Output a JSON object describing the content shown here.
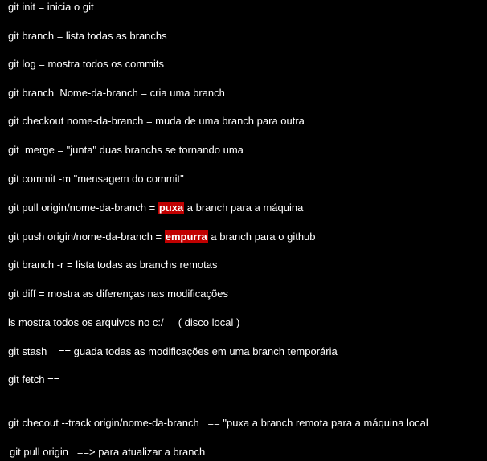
{
  "document": {
    "lines": [
      {
        "text": "git init = inicia o git"
      },
      {
        "text": "git branch = lista todas as branchs"
      },
      {
        "text": "git log = mostra todos os commits"
      },
      {
        "text": "git branch  Nome-da-branch = cria uma branch"
      },
      {
        "text": "git checkout nome-da-branch = muda de uma branch para outra"
      },
      {
        "text": "git  merge = \"junta\" duas branchs se tornando uma"
      },
      {
        "text": "git commit -m \"mensagem do commit\""
      },
      {
        "pre": "git pull origin/nome-da-branch = ",
        "highlight": "puxa",
        "post": " a branch para a máquina"
      },
      {
        "pre": "git push origin/nome-da-branch = ",
        "highlight": "empurra",
        "post": " a branch para o github"
      },
      {
        "text": "git branch -r = lista todas as branchs remotas"
      },
      {
        "text": "git diff = mostra as diferenças nas modificações"
      },
      {
        "text": "ls mostra todos os arquivos no c:/     ( disco local )"
      },
      {
        "text": "git stash    == guada todas as modificações em uma branch temporária"
      },
      {
        "text": "git fetch =="
      },
      {
        "text": "git checout --track origin/nome-da-branch   == \"puxa a branch remota para a máquina local"
      },
      {
        "text": "git pull origin   ==> para atualizar a branch"
      }
    ]
  },
  "colors": {
    "background": "#000000",
    "text": "#ffffff",
    "highlight": "#c00000"
  }
}
